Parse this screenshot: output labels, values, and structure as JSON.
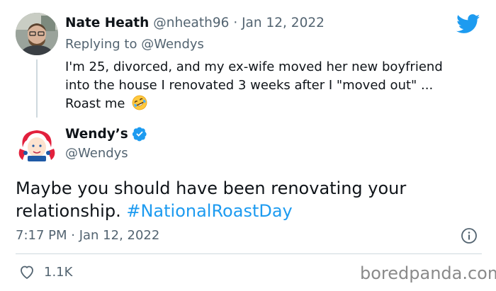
{
  "reply_tweet": {
    "name": "Nate Heath",
    "handle": "@nheath96",
    "date": "Jan 12, 2022",
    "separator": "·",
    "replying_prefix": "Replying to",
    "replying_to": "@Wendys",
    "body_lines": [
      "I'm 25, divorced, and my ex-wife moved her new boyfriend",
      "into the house I renovated 3 weeks after I \"moved out\" ...",
      "Roast me"
    ],
    "emoji": "rolling-on-floor-laughing-emoji"
  },
  "main_tweet": {
    "name": "Wendy’s",
    "verified": true,
    "handle": "@Wendys",
    "text_line1": "Maybe you should have been renovating your",
    "text_line2_plain": "relationship.",
    "hashtag": "#NationalRoastDay",
    "timestamp": "7:17 PM · Jan 12, 2022",
    "likes": "1.1K"
  },
  "icons": {
    "logo": "twitter-bird-icon",
    "info": "info-icon",
    "like": "heart-icon",
    "verified": "verified-badge-icon"
  },
  "colors": {
    "accent": "#1d9bf0",
    "secondary_text": "#536471",
    "primary_text": "#0f1419",
    "wendys_red": "#e2203d"
  },
  "watermark": "boredpanda.com"
}
